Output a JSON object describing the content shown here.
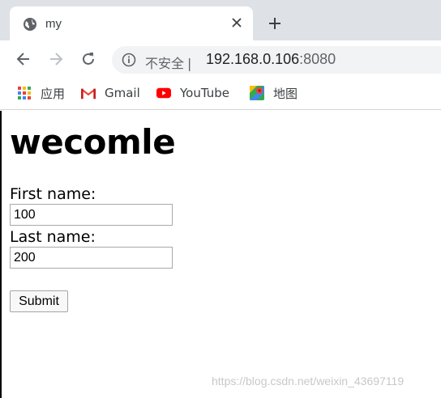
{
  "tab": {
    "title": "my",
    "icon": "globe-icon"
  },
  "toolbar": {
    "security_label": "不安全",
    "separator": "|",
    "host": "192.168.0.106",
    "port": ":8080"
  },
  "bookmarks": [
    {
      "label": "应用",
      "icon": "apps-grid-icon"
    },
    {
      "label": "Gmail",
      "icon": "gmail-icon"
    },
    {
      "label": "YouTube",
      "icon": "youtube-icon"
    },
    {
      "label": "地图",
      "icon": "maps-icon"
    }
  ],
  "page": {
    "heading": "wecomle",
    "first_name_label": "First name:",
    "first_name_value": "100",
    "last_name_label": "Last name:",
    "last_name_value": "200",
    "submit_label": "Submit",
    "watermark": "https://blog.csdn.net/weixin_43697119"
  },
  "colors": {
    "tabstrip_bg": "#dee1e6",
    "omnibox_bg": "#f1f3f4",
    "youtube_red": "#ff0000",
    "gmail_red": "#ea4335"
  }
}
